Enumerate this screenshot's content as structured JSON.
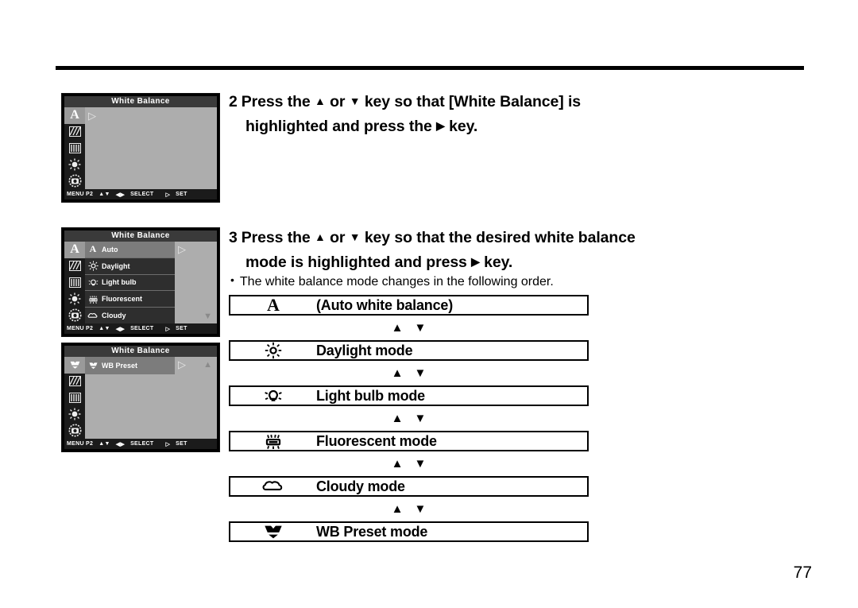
{
  "page": {
    "number": "77"
  },
  "steps": [
    {
      "number": "2",
      "line1_a": "Press the",
      "up": "▲",
      "or": "or",
      "down": "▼",
      "line1_b": "key so that [White Balance] is",
      "line2_a": "highlighted and press the",
      "right": "▶",
      "line2_b": "key."
    },
    {
      "number": "3",
      "line1_a": "Press the",
      "up": "▲",
      "or": "or",
      "down": "▼",
      "line1_b": "key so that the desired white balance",
      "line2_a": "mode is highlighted and press",
      "right": "▶",
      "line2_b": "key."
    }
  ],
  "note": {
    "bullet": "•",
    "text": "The white balance mode changes in the following order."
  },
  "lcd_screens": [
    {
      "title": "White Balance",
      "icon_column": [
        "A",
        "hatch-pattern-icon",
        "bars-icon",
        "brightness-icon",
        "camera-reset-icon"
      ],
      "selected_icon_index": 0,
      "menu_items": [],
      "cursor": "▷",
      "scroll_arrow": "",
      "status": {
        "menu": "MENU P2",
        "updown": "▲▼",
        "leftright": "◀▶",
        "select": "SELECT",
        "set_glyph": "▷",
        "set": "SET"
      }
    },
    {
      "title": "White Balance",
      "icon_column": [
        "A",
        "hatch-pattern-icon",
        "bars-icon",
        "brightness-icon",
        "camera-reset-icon"
      ],
      "selected_icon_index": 0,
      "menu_items": [
        {
          "icon": "auto-a-icon",
          "label": "Auto",
          "selected": true
        },
        {
          "icon": "daylight-sun-icon",
          "label": "Daylight",
          "selected": false
        },
        {
          "icon": "light-bulb-icon",
          "label": "Light bulb",
          "selected": false
        },
        {
          "icon": "fluorescent-icon",
          "label": "Fluorescent",
          "selected": false
        },
        {
          "icon": "cloudy-icon",
          "label": "Cloudy",
          "selected": false
        }
      ],
      "cursor": "▷",
      "scroll_arrow": "▼",
      "status": {
        "menu": "MENU P2",
        "updown": "▲▼",
        "leftright": "◀▶",
        "select": "SELECT",
        "set_glyph": "▷",
        "set": "SET"
      }
    },
    {
      "title": "White Balance",
      "icon_column": [
        "wb-preset-icon",
        "hatch-pattern-icon",
        "bars-icon",
        "brightness-icon",
        "camera-reset-icon"
      ],
      "selected_icon_index": 0,
      "menu_items": [
        {
          "icon": "wb-preset-icon",
          "label": "WB Preset",
          "selected": true
        }
      ],
      "cursor": "▷",
      "scroll_arrow": "▲",
      "status": {
        "menu": "MENU P2",
        "updown": "▲▼",
        "leftright": "◀▶",
        "select": "SELECT",
        "set_glyph": "▷",
        "set": "SET"
      }
    }
  ],
  "flow": {
    "separator": {
      "up": "▲",
      "down": "▼"
    },
    "items": [
      {
        "icon": "auto-a-icon",
        "label": "(Auto white balance)"
      },
      {
        "icon": "daylight-sun-icon",
        "label": "Daylight  mode"
      },
      {
        "icon": "light-bulb-icon",
        "label": "Light bulb mode"
      },
      {
        "icon": "fluorescent-icon",
        "label": "Fluorescent mode"
      },
      {
        "icon": "cloudy-icon",
        "label": "Cloudy mode"
      },
      {
        "icon": "wb-preset-icon",
        "label": "WB Preset mode"
      }
    ]
  }
}
